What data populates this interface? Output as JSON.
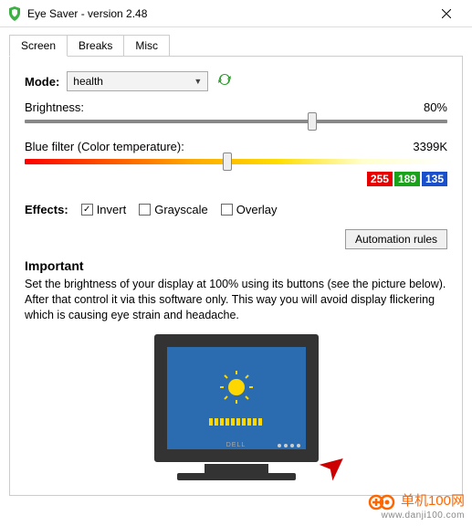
{
  "titlebar": {
    "title": "Eye Saver - version 2.48"
  },
  "tabs": {
    "screen": "Screen",
    "breaks": "Breaks",
    "misc": "Misc"
  },
  "mode": {
    "label": "Mode:",
    "value": "health"
  },
  "brightness": {
    "label": "Brightness:",
    "value": "80%",
    "pct": 68
  },
  "bluefilter": {
    "label": "Blue filter (Color temperature):",
    "value": "3399K",
    "pct": 48
  },
  "rgb": {
    "r": "255",
    "g": "189",
    "b": "135"
  },
  "effects": {
    "label": "Effects:",
    "invert": {
      "label": "Invert",
      "checked": true
    },
    "grayscale": {
      "label": "Grayscale",
      "checked": false
    },
    "overlay": {
      "label": "Overlay",
      "checked": false
    }
  },
  "automation": {
    "label": "Automation rules"
  },
  "important": {
    "title": "Important",
    "text": "Set the brightness of your display at 100% using its buttons (see the picture below). After that control it via this software only. This way you will avoid display flickering which is causing eye strain and headache."
  },
  "monitor": {
    "brand": "DELL"
  },
  "watermark": {
    "cn": "单机100网",
    "url": "www.danji100.com"
  },
  "colors": {
    "r": "#e60000",
    "g": "#1aa31a",
    "b": "#1a4fcc"
  }
}
